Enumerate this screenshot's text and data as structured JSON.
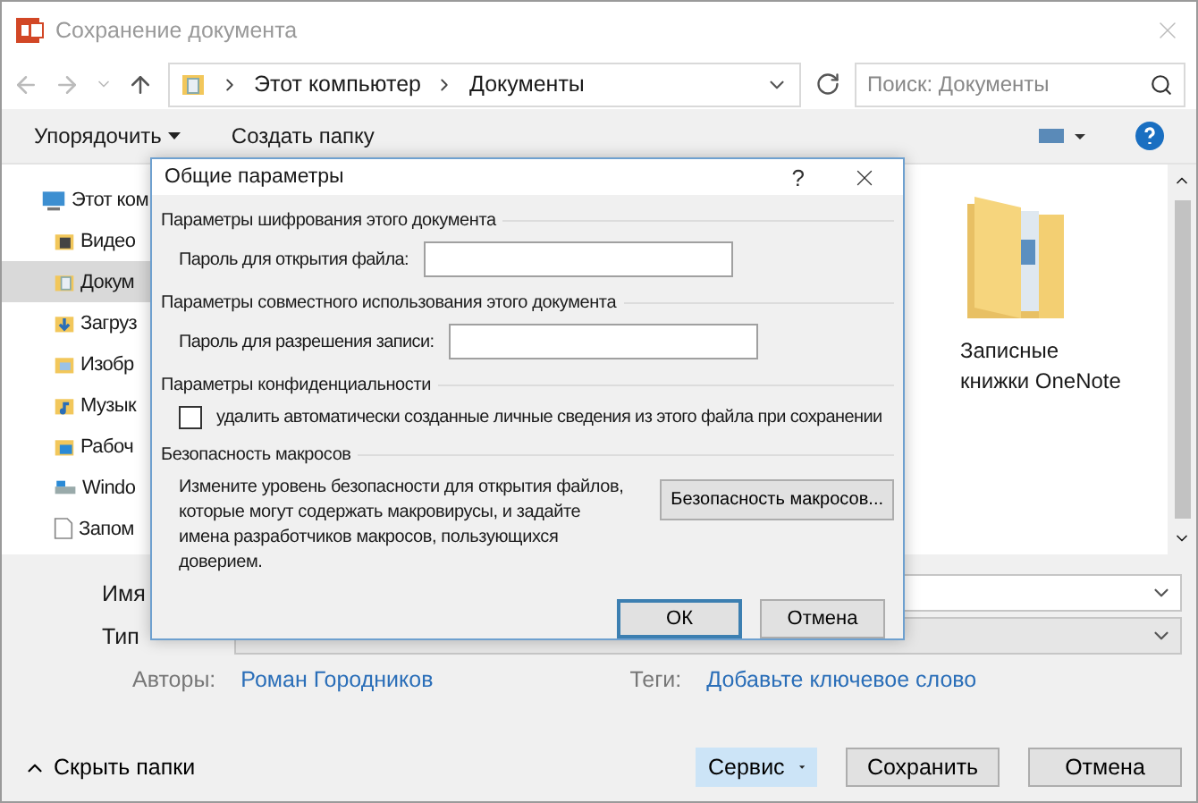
{
  "window": {
    "title": "Сохранение документа"
  },
  "nav": {
    "path": [
      "Этот компьютер",
      "Документы"
    ],
    "search": {
      "placeholder": "Поиск: Документы"
    }
  },
  "toolbar": {
    "items": [
      {
        "label": "Упорядочить",
        "kind": "menu"
      },
      {
        "label": "Создать папку",
        "kind": "plain"
      }
    ]
  },
  "sidebar": {
    "items": [
      {
        "label": "Этот ком",
        "kind": "computer",
        "selected": false,
        "children": [
          {
            "label": "Видео",
            "kind": "video",
            "selected": false
          },
          {
            "label": "Докум",
            "kind": "documents",
            "selected": true
          },
          {
            "label": "Загруз",
            "kind": "downloads",
            "selected": false
          },
          {
            "label": "Изобр",
            "kind": "pictures",
            "selected": false
          },
          {
            "label": "Музык",
            "kind": "music",
            "selected": false
          },
          {
            "label": "Рабоч",
            "kind": "desktop",
            "selected": false
          },
          {
            "label": "Windo",
            "kind": "drive",
            "selected": false
          },
          {
            "label": "Запом",
            "kind": "file",
            "selected": false
          }
        ]
      }
    ]
  },
  "files": [
    {
      "name": "Записные книжки OneNote"
    }
  ],
  "form": {
    "fields": [
      {
        "label": "Имя",
        "kind": "white"
      },
      {
        "label": "Тип",
        "kind": "grey"
      }
    ],
    "authors": {
      "label": "Авторы:",
      "value": "Роман Городников"
    },
    "tags": {
      "label": "Теги:",
      "value": "Добавьте ключевое слово"
    }
  },
  "footer": {
    "hide_folders": "Скрыть папки",
    "buttons": [
      {
        "label": "Сервис",
        "kind": "menu"
      },
      {
        "label": "Сохранить",
        "kind": "plain"
      },
      {
        "label": "Отмена",
        "kind": "plain"
      }
    ]
  },
  "modal": {
    "title": "Общие параметры",
    "help": "?",
    "sections": [
      {
        "heading": "Параметры шифрования этого документа",
        "kind": "password",
        "label": "Пароль для открытия файла:"
      },
      {
        "heading": "Параметры совместного использования этого документа",
        "kind": "password",
        "label": "Пароль для разрешения записи:"
      },
      {
        "heading": "Параметры конфиденциальности",
        "kind": "checkbox",
        "label": "удалить автоматически созданные личные сведения из этого файла при сохранении",
        "checked": false
      },
      {
        "heading": "Безопасность макросов",
        "kind": "macro",
        "text": "Измените уровень безопасности для открытия файлов, которые могут содержать макровирусы, и задайте имена разработчиков макросов, пользующихся доверием.",
        "button": "Безопасность макросов..."
      }
    ],
    "buttons": [
      {
        "label": "ОК",
        "default": true
      },
      {
        "label": "Отмена",
        "default": false
      }
    ]
  }
}
